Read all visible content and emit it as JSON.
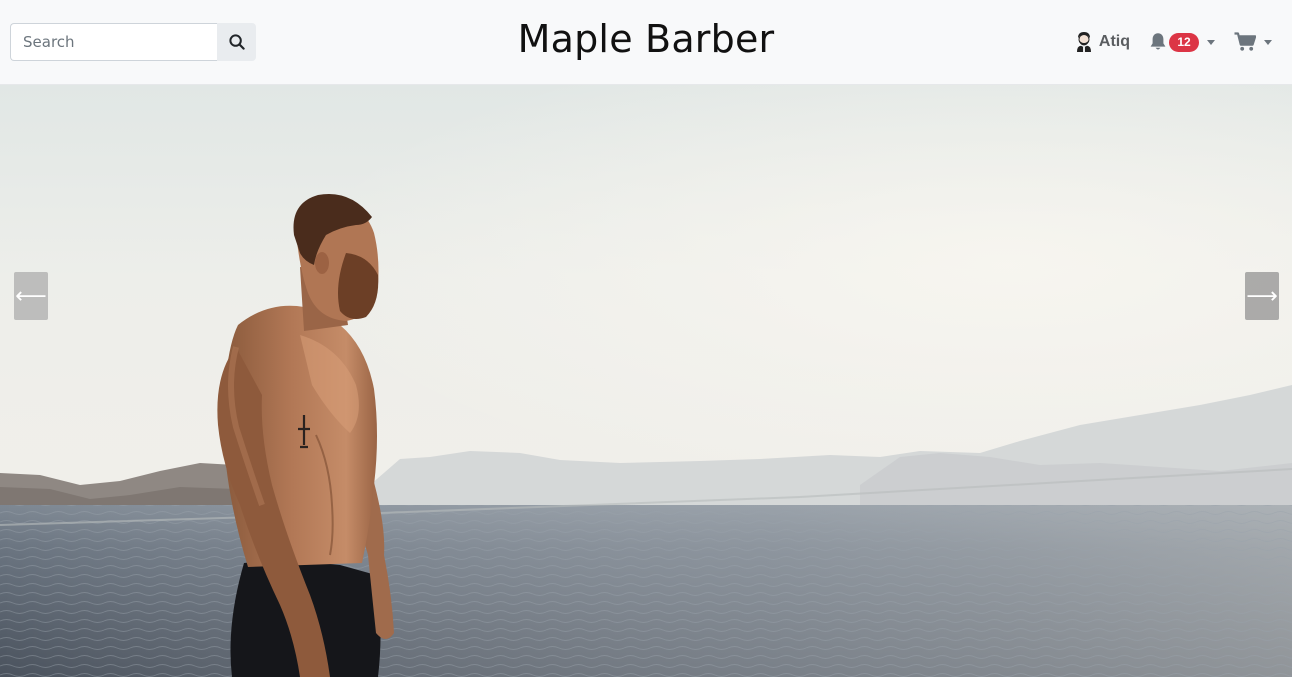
{
  "search": {
    "placeholder": "Search",
    "value": ""
  },
  "brand": {
    "title": "Maple Barber"
  },
  "user": {
    "name": "Atiq",
    "avatar_icon": "barber-avatar-icon"
  },
  "notifications": {
    "icon": "bell-icon",
    "count": "12",
    "badge_color": "#dc3545"
  },
  "cart": {
    "icon": "cart-icon"
  },
  "carousel": {
    "prev_glyph": "⟵",
    "next_glyph": "⟶"
  },
  "colors": {
    "navbar_bg": "#f8f9fa",
    "search_button_bg": "#e9ecef",
    "brand_text": "#111111"
  }
}
